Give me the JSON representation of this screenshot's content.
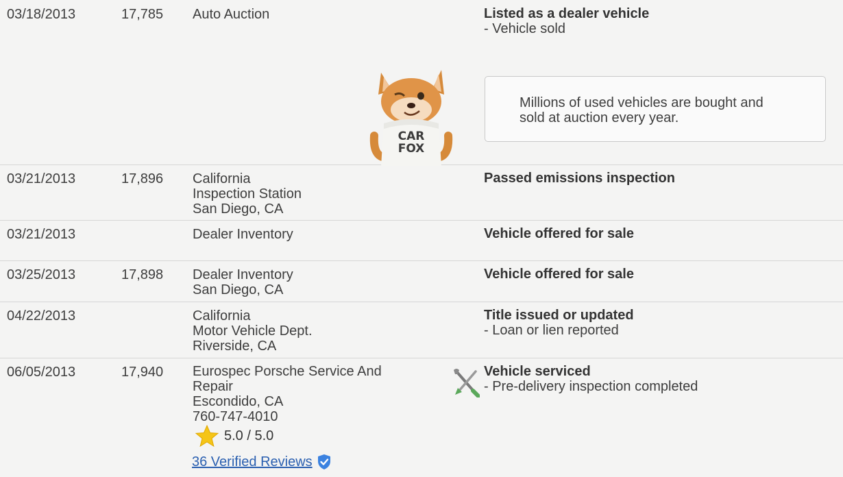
{
  "records": [
    {
      "date": "03/18/2013",
      "odometer": "17,785",
      "source": [
        "Auto Auction"
      ],
      "event_title": "Listed as a dealer vehicle",
      "event_details": [
        "- Vehicle sold"
      ]
    },
    {
      "date": "03/21/2013",
      "odometer": "17,896",
      "source": [
        "California",
        "Inspection Station",
        "San Diego, CA"
      ],
      "event_title": "Passed emissions inspection",
      "event_details": []
    },
    {
      "date": "03/21/2013",
      "odometer": "",
      "source": [
        "Dealer Inventory"
      ],
      "event_title": "Vehicle offered for sale",
      "event_details": []
    },
    {
      "date": "03/25/2013",
      "odometer": "17,898",
      "source": [
        "Dealer Inventory",
        "San Diego, CA"
      ],
      "event_title": "Vehicle offered for sale",
      "event_details": []
    },
    {
      "date": "04/22/2013",
      "odometer": "",
      "source": [
        "California",
        "Motor Vehicle Dept.",
        "Riverside, CA"
      ],
      "event_title": "Title issued or updated",
      "event_details": [
        "- Loan or lien reported"
      ]
    },
    {
      "date": "06/05/2013",
      "odometer": "17,940",
      "source": [
        "Eurospec Porsche Service And",
        "Repair",
        "Escondido, CA",
        "760-747-4010"
      ],
      "event_title": "Vehicle serviced",
      "event_details": [
        "- Pre-delivery inspection completed"
      ]
    }
  ],
  "callout": {
    "text_line1": "Millions of used vehicles are bought and",
    "text_line2": "sold at auction every year."
  },
  "mascot": {
    "shirt_line1": "CAR",
    "shirt_line2": "FOX",
    "icon": "carfox-mascot-icon"
  },
  "rating": {
    "value": "5.0 / 5.0",
    "icon": "star-icon"
  },
  "reviews": {
    "link_text": "36 Verified Reviews",
    "icon": "verified-badge-icon"
  },
  "colors": {
    "link": "#2a5fb0",
    "star": "#f5c518",
    "badge": "#3b82e0",
    "border": "#d6d6d6"
  }
}
